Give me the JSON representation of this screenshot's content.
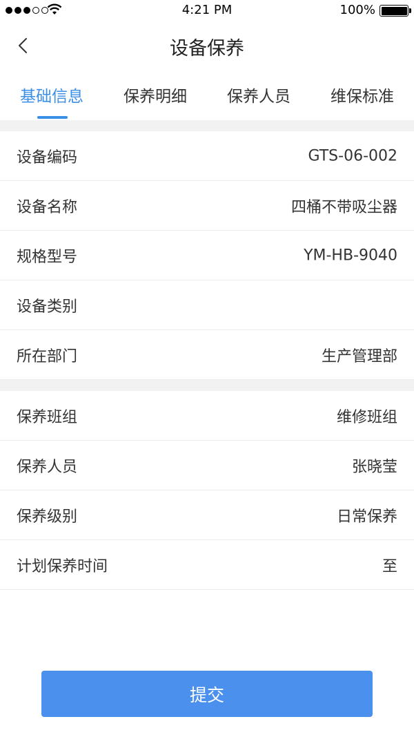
{
  "status_bar": {
    "time": "4:21 PM",
    "battery": "100%",
    "signal_bars": 3,
    "wifi_icon": "wifi-icon"
  },
  "nav": {
    "title": "设备保养",
    "back_icon": "chevron-left-icon"
  },
  "tabs": [
    {
      "label": "基础信息",
      "active": true
    },
    {
      "label": "保养明细",
      "active": false
    },
    {
      "label": "保养人员",
      "active": false
    },
    {
      "label": "维保标准",
      "active": false
    }
  ],
  "section1": [
    {
      "label": "设备编码",
      "value": "GTS-06-002"
    },
    {
      "label": "设备名称",
      "value": "四桶不带吸尘器"
    },
    {
      "label": "规格型号",
      "value": "YM-HB-9040"
    },
    {
      "label": "设备类别",
      "value": ""
    },
    {
      "label": "所在部门",
      "value": "生产管理部"
    }
  ],
  "section2": [
    {
      "label": "保养班组",
      "value": "维修班组"
    },
    {
      "label": "保养人员",
      "value": "张晓莹"
    },
    {
      "label": "保养级别",
      "value": "日常保养"
    },
    {
      "label": "计划保养时间",
      "value": "至"
    }
  ],
  "submit_label": "提交",
  "colors": {
    "accent": "#3b8fe6",
    "button": "#4b90ec",
    "divider": "#f2f2f2"
  }
}
